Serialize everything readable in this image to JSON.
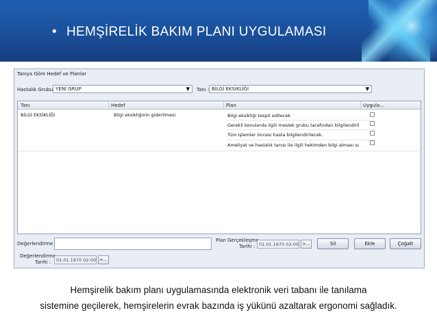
{
  "slide": {
    "title": "HEMŞİRELİK BAKIM PLANI UYGULAMASI",
    "bullet": "•",
    "caption_line1": "Hemşirelik bakım planı uygulamasında elektronik veri tabanı ile tanılama",
    "caption_line2": "sistemine geçilerek, hemşirelerin evrak bazında iş yükünü azaltarak ergonomi sağladık."
  },
  "window": {
    "group_title": "Tanıya Göre Hedef ve Planlar",
    "patient_group_label": "Hastalık Grubu :",
    "patient_group_value": "YENİ GRUP",
    "diagnosis_label": "Tanı :",
    "diagnosis_value": "BİLGİ EKSİKLİĞİ",
    "dropdown_arrow": "▼",
    "columns": [
      "Tanı",
      "Hedef",
      "Plan",
      "Uygula..."
    ],
    "row": {
      "tani": "BİLGİ EKSİKLİĞİ",
      "hedef": "Bilgi eksikliğinin giderilmesi",
      "plans": [
        "Bilgi eksikliği tespit edilecek",
        "Gerekli konularda ilgili meslek grubu  tarafından bilgilendiril...",
        "Tüm işlemler öncesi hasta bilgilendirilecek.",
        "Ameliyat ve hastalık tanısı ile ilgili hekimden bilgi alması sağl..."
      ]
    },
    "evaluation_label": "Değerlendirme :",
    "plan_date_label_1": "Plan Gerçekleşme",
    "plan_date_label_2": "Tarihi :",
    "plan_date_value": "01.01.1970 02:00:",
    "eval_date_label_1": "Değerlendirme",
    "eval_date_label_2": "Tarihi :",
    "eval_date_value": "01.01.1970 02:00:",
    "ellipsis_button": ">...",
    "delete_button": "Sil",
    "add_button": "Ekle",
    "copy_button": "Çoğalt"
  }
}
